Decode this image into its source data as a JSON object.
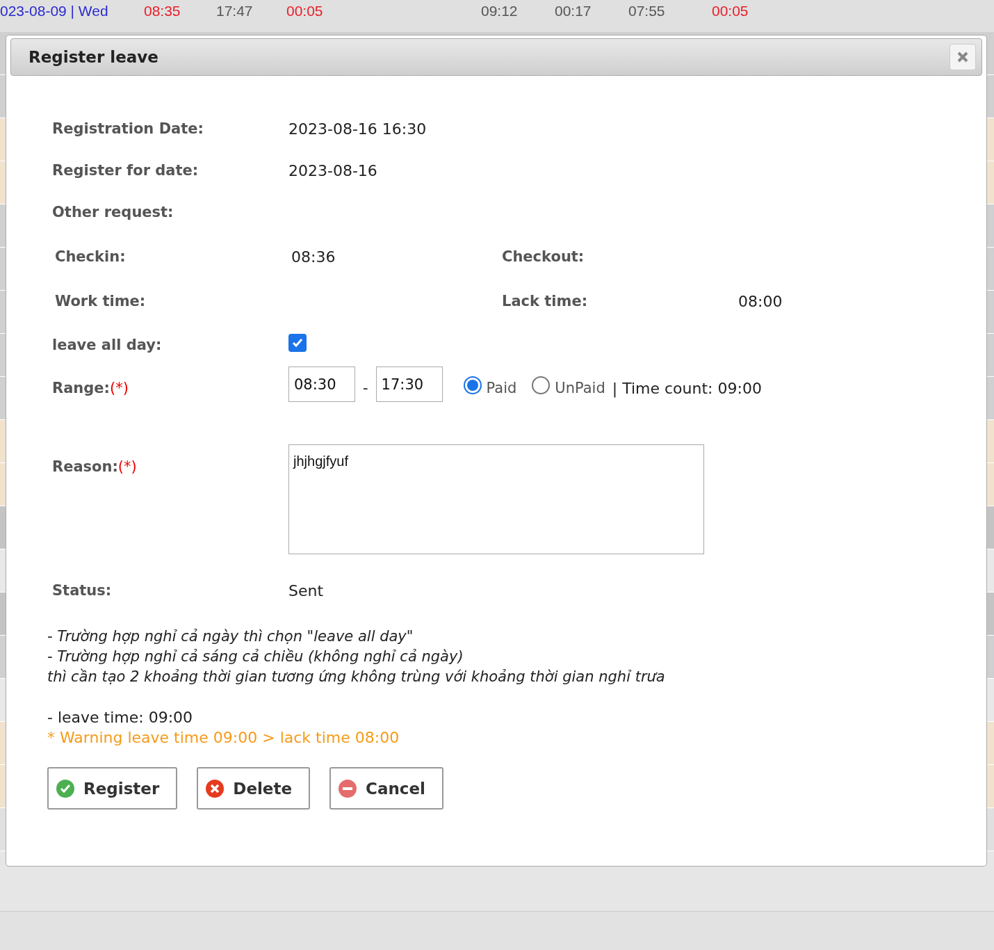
{
  "background_row": {
    "date": "023-08-09 | Wed",
    "cells": [
      {
        "text": "08:35",
        "kind": "late"
      },
      {
        "text": "17:47",
        "kind": "normal"
      },
      {
        "text": "00:05",
        "kind": "late"
      },
      {
        "text": "09:12",
        "kind": "normal"
      },
      {
        "text": "00:17",
        "kind": "normal"
      },
      {
        "text": "07:55",
        "kind": "normal"
      },
      {
        "text": "00:05",
        "kind": "late"
      }
    ]
  },
  "dialog": {
    "title": "Register leave",
    "registration_date": {
      "label": "Registration Date:",
      "value": "2023-08-16 16:30"
    },
    "register_for_date": {
      "label": "Register for date:",
      "value": "2023-08-16"
    },
    "other_request": {
      "label": "Other request:"
    },
    "checkin": {
      "label": "Checkin:",
      "value": "08:36"
    },
    "checkout": {
      "label": "Checkout:"
    },
    "work_time": {
      "label": "Work time:"
    },
    "lack_time": {
      "label": "Lack time:",
      "value": "08:00"
    },
    "leave_all_day": {
      "label": "leave all day:",
      "checked": true
    },
    "range": {
      "label": "Range:",
      "required": "(*)",
      "from": "08:30",
      "separator": "-",
      "to": "17:30",
      "pay_options": [
        {
          "label": "Paid",
          "selected": true
        },
        {
          "label": "UnPaid",
          "selected": false
        }
      ],
      "time_count": "| Time count: 09:00"
    },
    "reason": {
      "label": "Reason:",
      "required": "(*)",
      "value": "jhjhgjfyuf"
    },
    "status": {
      "label": "Status:",
      "value": "Sent"
    },
    "notes": [
      "- Trường hợp nghỉ cả ngày thì chọn \"leave all day\"",
      "- Trường hợp nghỉ cả sáng cả chiều (không nghỉ cả ngày)",
      "thì cần tạo 2 khoảng thời gian tương ứng không trùng với khoảng thời gian nghỉ trưa"
    ],
    "leave_time": "- leave time: 09:00",
    "warning": "* Warning leave time 09:00 > lack time 08:00",
    "buttons": [
      {
        "label": "Register",
        "kind": "ok"
      },
      {
        "label": "Delete",
        "kind": "delete"
      },
      {
        "label": "Cancel",
        "kind": "cancel"
      }
    ]
  }
}
